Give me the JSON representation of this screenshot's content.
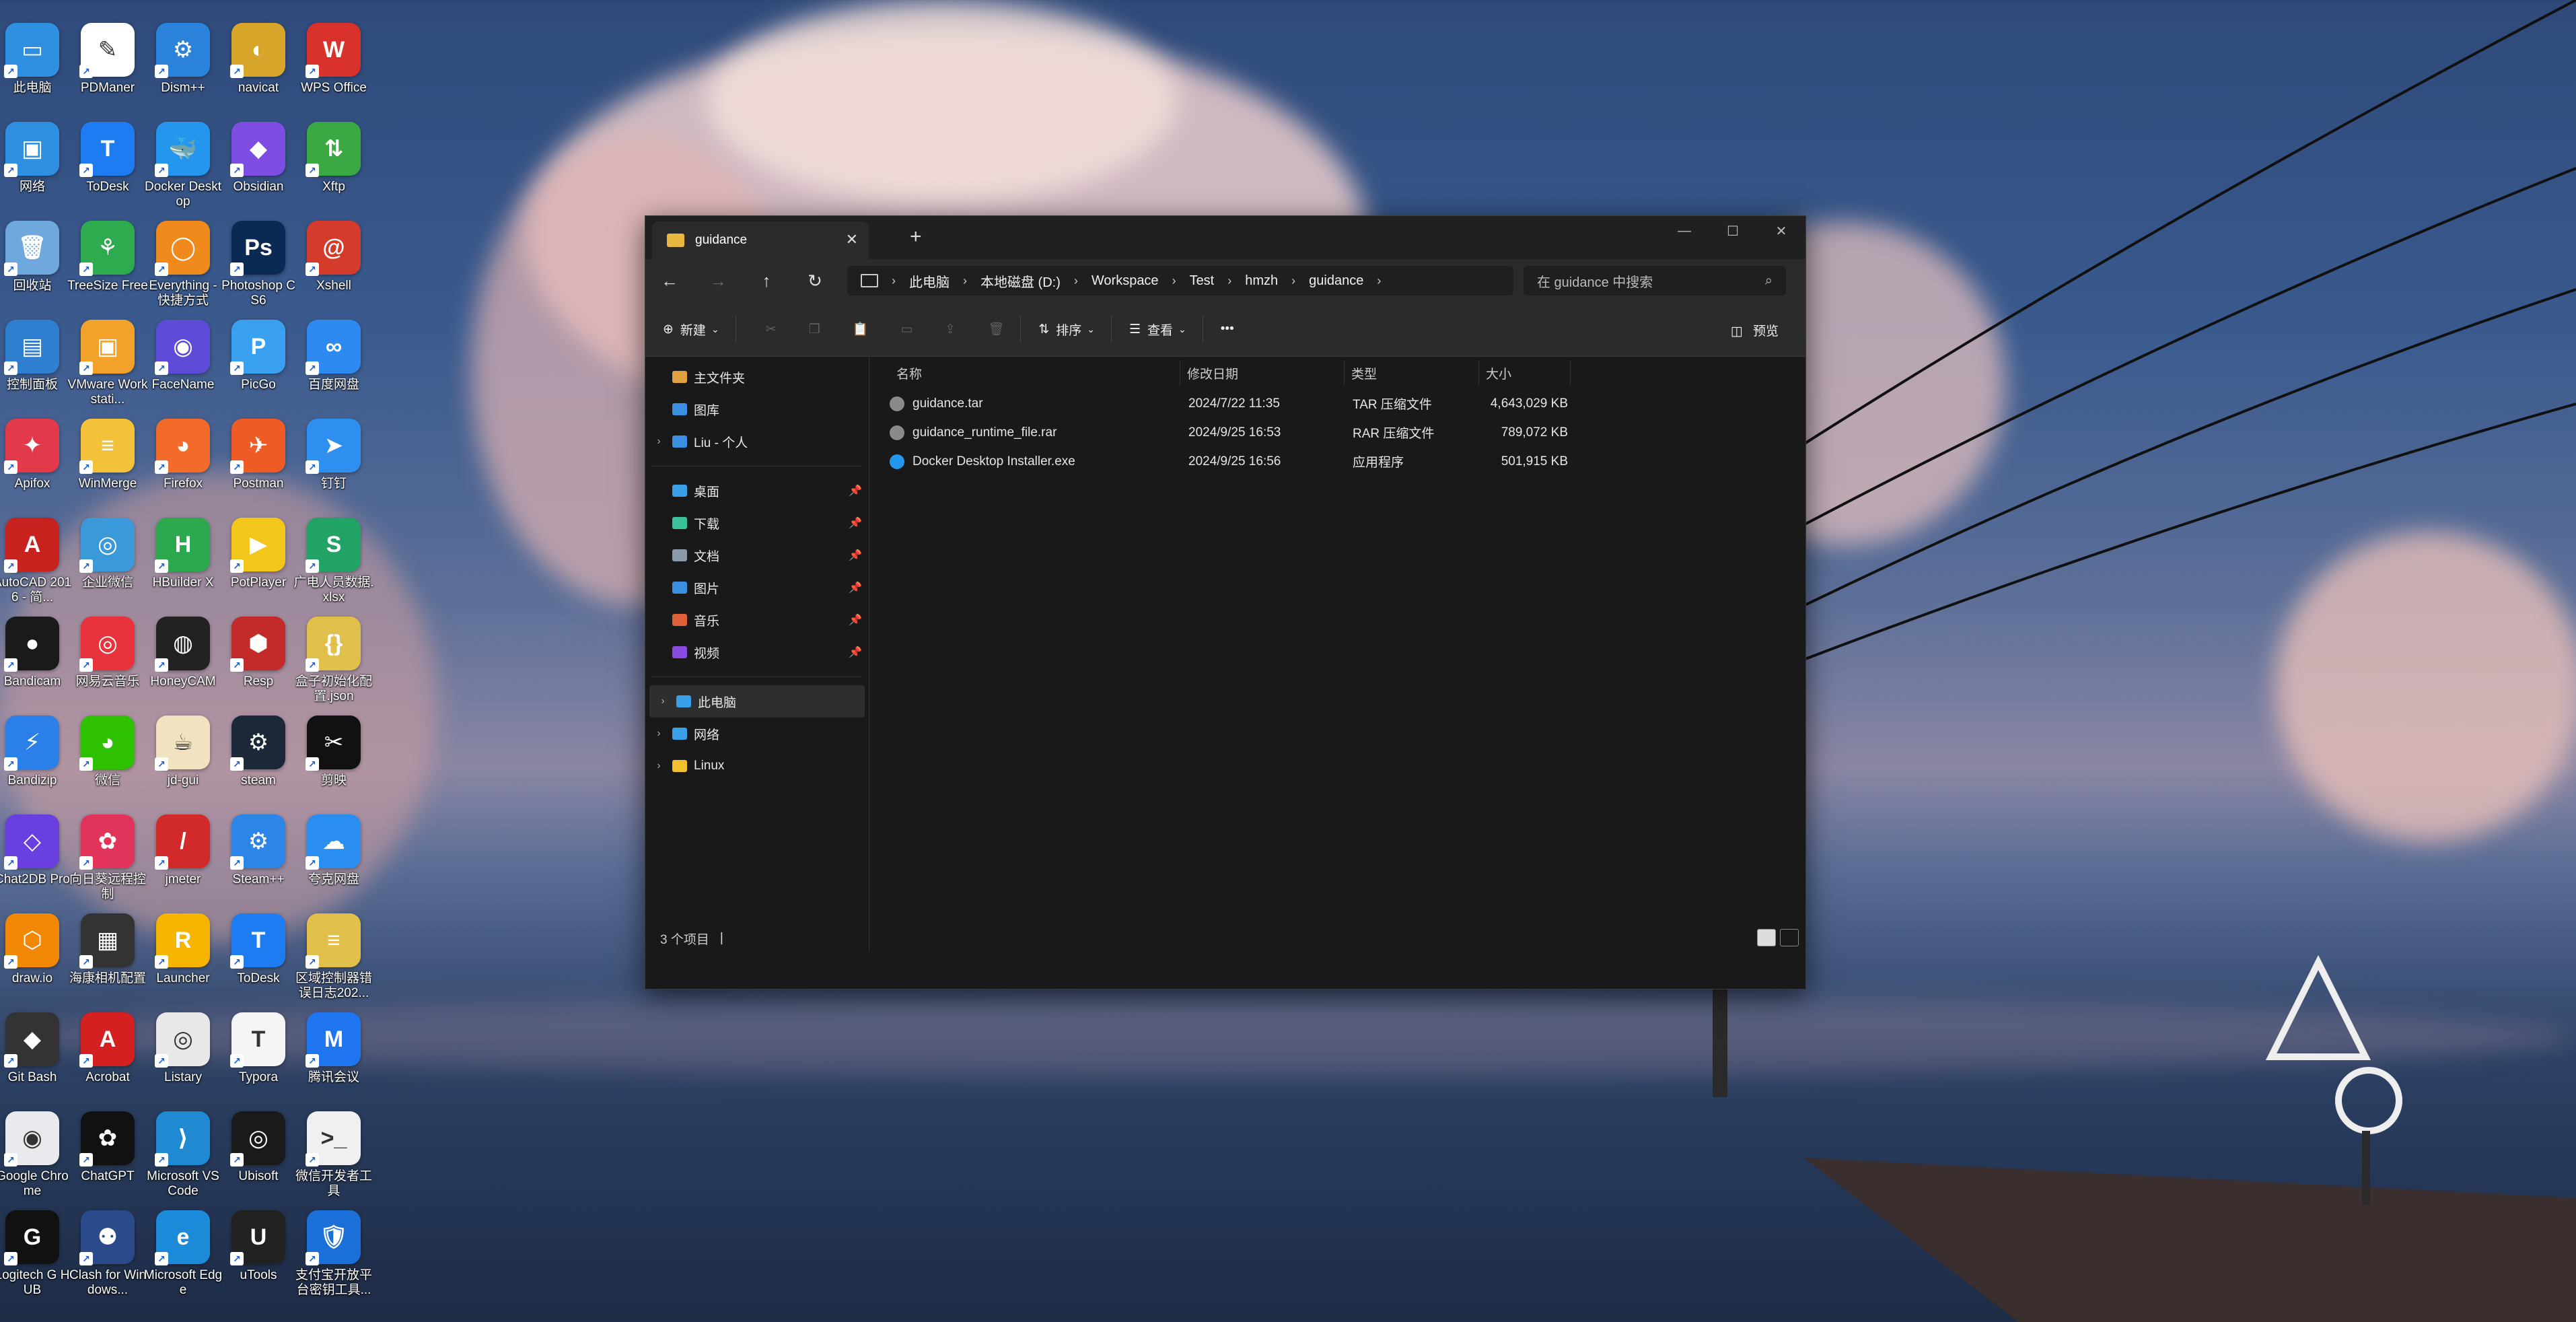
{
  "desktop": {
    "icons": [
      {
        "label": "此电脑",
        "color": "#2f8fe0",
        "glyph": "▭"
      },
      {
        "label": "PDManer",
        "color": "#ffffff",
        "glyph": "✎"
      },
      {
        "label": "Dism++",
        "color": "#2a82da",
        "glyph": "⚙"
      },
      {
        "label": "navicat",
        "color": "#d6a52a",
        "glyph": "◐"
      },
      {
        "label": "WPS Office",
        "color": "#d9322c",
        "glyph": "W"
      },
      {
        "label": "网络",
        "color": "#2f8fe0",
        "glyph": "▣"
      },
      {
        "label": "ToDesk",
        "color": "#1d7cf2",
        "glyph": "T"
      },
      {
        "label": "Docker Desktop",
        "color": "#2496ed",
        "glyph": "🐳"
      },
      {
        "label": "Obsidian",
        "color": "#7c4de0",
        "glyph": "◆"
      },
      {
        "label": "Xftp",
        "color": "#3aa843",
        "glyph": "⇅"
      },
      {
        "label": "回收站",
        "color": "#6fa8dc",
        "glyph": "🗑"
      },
      {
        "label": "TreeSize Free",
        "color": "#2eaa4f",
        "glyph": "⚘"
      },
      {
        "label": "Everything - 快捷方式",
        "color": "#f08a1c",
        "glyph": "◯"
      },
      {
        "label": "Photoshop CS6",
        "color": "#0a2a55",
        "glyph": "Ps"
      },
      {
        "label": "Xshell",
        "color": "#d43b2a",
        "glyph": "@"
      },
      {
        "label": "控制面板",
        "color": "#2f7fd0",
        "glyph": "▤"
      },
      {
        "label": "VMware Workstati...",
        "color": "#f2a12a",
        "glyph": "▣"
      },
      {
        "label": "FaceName",
        "color": "#5d4bd8",
        "glyph": "◉"
      },
      {
        "label": "PicGo",
        "color": "#3aa0f0",
        "glyph": "P"
      },
      {
        "label": "百度网盘",
        "color": "#2e89f0",
        "glyph": "∞"
      },
      {
        "label": "Apifox",
        "color": "#e23a4a",
        "glyph": "✦"
      },
      {
        "label": "WinMerge",
        "color": "#f3c23a",
        "glyph": "≡"
      },
      {
        "label": "Firefox",
        "color": "#f36b2a",
        "glyph": "◕"
      },
      {
        "label": "Postman",
        "color": "#ef5b25",
        "glyph": "✈"
      },
      {
        "label": "钉钉",
        "color": "#2f8ff0",
        "glyph": "➤"
      },
      {
        "label": "AutoCAD 2016 - 简...",
        "color": "#c8221f",
        "glyph": "A"
      },
      {
        "label": "企业微信",
        "color": "#3a9ad9",
        "glyph": "◎"
      },
      {
        "label": "HBuilder X",
        "color": "#2ca84f",
        "glyph": "H"
      },
      {
        "label": "PotPlayer",
        "color": "#f3c61b",
        "glyph": "▶"
      },
      {
        "label": "广电人员数据.xlsx",
        "color": "#21a366",
        "glyph": "S"
      },
      {
        "label": "Bandicam",
        "color": "#1a1a1a",
        "glyph": "●"
      },
      {
        "label": "网易云音乐",
        "color": "#e8323c",
        "glyph": "◎"
      },
      {
        "label": "HoneyCAM",
        "color": "#222222",
        "glyph": "◍"
      },
      {
        "label": "Resp",
        "color": "#c32b2b",
        "glyph": "⬢"
      },
      {
        "label": "盒子初始化配置.json",
        "color": "#e0c04a",
        "glyph": "{}"
      },
      {
        "label": "Bandizip",
        "color": "#2b7fe8",
        "glyph": "⚡"
      },
      {
        "label": "微信",
        "color": "#2dc100",
        "glyph": "◕"
      },
      {
        "label": "jd-gui",
        "color": "#f2e3c0",
        "glyph": "☕"
      },
      {
        "label": "steam",
        "color": "#1b2838",
        "glyph": "⚙"
      },
      {
        "label": "剪映",
        "color": "#111111",
        "glyph": "✂"
      },
      {
        "label": "Chat2DB Pro",
        "color": "#6a3fe0",
        "glyph": "◇"
      },
      {
        "label": "向日葵远程控制",
        "color": "#e2345a",
        "glyph": "✿"
      },
      {
        "label": "jmeter",
        "color": "#d22a2a",
        "glyph": "/"
      },
      {
        "label": "Steam++",
        "color": "#2c86e8",
        "glyph": "⚙"
      },
      {
        "label": "夸克网盘",
        "color": "#2a8ef0",
        "glyph": "☁"
      },
      {
        "label": "draw.io",
        "color": "#f08705",
        "glyph": "⬡"
      },
      {
        "label": "海康相机配置",
        "color": "#333333",
        "glyph": "▦"
      },
      {
        "label": "Launcher",
        "color": "#f4b400",
        "glyph": "R"
      },
      {
        "label": "ToDesk",
        "color": "#1d7cf2",
        "glyph": "T"
      },
      {
        "label": "区域控制器错误日志202...",
        "color": "#e0c04a",
        "glyph": "≡"
      },
      {
        "label": "Git Bash",
        "color": "#333333",
        "glyph": "◆"
      },
      {
        "label": "Acrobat",
        "color": "#d42020",
        "glyph": "A"
      },
      {
        "label": "Listary",
        "color": "#e8e8e8",
        "glyph": "◎"
      },
      {
        "label": "Typora",
        "color": "#f5f5f5",
        "glyph": "T"
      },
      {
        "label": "腾讯会议",
        "color": "#1f74f0",
        "glyph": "M"
      },
      {
        "label": "Google Chrome",
        "color": "#e8eaed",
        "glyph": "◉"
      },
      {
        "label": "ChatGPT",
        "color": "#111111",
        "glyph": "✿"
      },
      {
        "label": "Microsoft VS Code",
        "color": "#1f8ad2",
        "glyph": "⟩"
      },
      {
        "label": "Ubisoft",
        "color": "#1a1a1a",
        "glyph": "◎"
      },
      {
        "label": "微信开发者工具",
        "color": "#f0f0f0",
        "glyph": ">_"
      },
      {
        "label": "Logitech G HUB",
        "color": "#111111",
        "glyph": "G"
      },
      {
        "label": "Clash for Windows...",
        "color": "#2b4a8a",
        "glyph": "⚉"
      },
      {
        "label": "Microsoft Edge",
        "color": "#1b8ad8",
        "glyph": "e"
      },
      {
        "label": "uTools",
        "color": "#222222",
        "glyph": "U"
      },
      {
        "label": "支付宝开放平台密钥工具...",
        "color": "#1a6fd8",
        "glyph": "🛡"
      }
    ]
  },
  "window": {
    "tab_title": "guidance",
    "tab_close": "✕",
    "new_tab": "+",
    "controls": {
      "minimize": "—",
      "maximize": "☐",
      "close": "✕"
    },
    "nav": {
      "back": "←",
      "forward": "→",
      "up": "↑",
      "refresh": "↻"
    },
    "breadcrumbs": [
      "此电脑",
      "本地磁盘 (D:)",
      "Workspace",
      "Test",
      "hmzh",
      "guidance"
    ],
    "search_placeholder": "在 guidance 中搜索",
    "toolbar": {
      "new": "新建",
      "sort": "排序",
      "view": "查看",
      "more": "•••",
      "preview": "预览"
    },
    "sidebar": {
      "top": [
        {
          "label": "主文件夹",
          "icon": "home-icon",
          "color": "#e0a040",
          "chev": ""
        },
        {
          "label": "图库",
          "icon": "gallery-icon",
          "color": "#3a8fe0",
          "chev": ""
        },
        {
          "label": "Liu - 个人",
          "icon": "onedrive-icon",
          "color": "#3a8fe0",
          "chev": "›"
        }
      ],
      "quick": [
        {
          "label": "桌面",
          "icon": "desktop-icon",
          "color": "#3aa0e8"
        },
        {
          "label": "下载",
          "icon": "download-icon",
          "color": "#3ac09a"
        },
        {
          "label": "文档",
          "icon": "documents-icon",
          "color": "#8a9aaa"
        },
        {
          "label": "图片",
          "icon": "pictures-icon",
          "color": "#3a8fe0"
        },
        {
          "label": "音乐",
          "icon": "music-icon",
          "color": "#e0603a"
        },
        {
          "label": "视频",
          "icon": "videos-icon",
          "color": "#8a4ae0"
        }
      ],
      "drives": [
        {
          "label": "此电脑",
          "icon": "pc-icon",
          "color": "#3aa0e8"
        },
        {
          "label": "网络",
          "icon": "network-icon",
          "color": "#3aa0e8"
        },
        {
          "label": "Linux",
          "icon": "linux-icon",
          "color": "#f0c030"
        }
      ]
    },
    "columns": [
      "名称",
      "修改日期",
      "类型",
      "大小"
    ],
    "files": [
      {
        "name": "guidance.tar",
        "date": "2024/7/22 11:35",
        "type": "TAR 压缩文件",
        "size": "4,643,029 KB",
        "color": "#8a8a8a"
      },
      {
        "name": "guidance_runtime_file.rar",
        "date": "2024/9/25 16:53",
        "type": "RAR 压缩文件",
        "size": "789,072 KB",
        "color": "#8a8a8a"
      },
      {
        "name": "Docker Desktop Installer.exe",
        "date": "2024/9/25 16:56",
        "type": "应用程序",
        "size": "501,915 KB",
        "color": "#2496ed"
      }
    ],
    "status": "3 个项目"
  }
}
